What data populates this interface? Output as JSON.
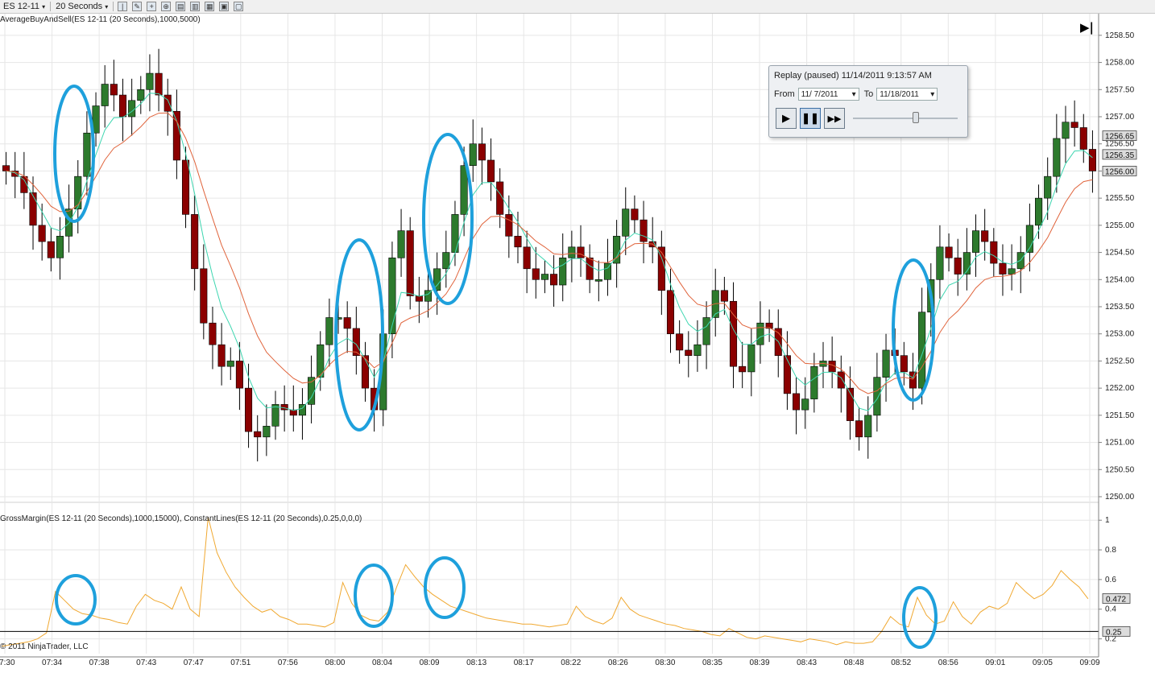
{
  "toolbar": {
    "instrument": "ES 12-11",
    "interval": "20 Seconds"
  },
  "upper_panel": {
    "indicator_label": "AverageBuyAndSell(ES 12-11 (20 Seconds),1000,5000)",
    "price_ticks": [
      "1258.50",
      "1258.00",
      "1257.50",
      "1257.00",
      "1256.50",
      "1256.00",
      "1255.50",
      "1255.00",
      "1254.50",
      "1254.00",
      "1253.50",
      "1253.00",
      "1252.50",
      "1252.00",
      "1251.50",
      "1251.00",
      "1250.50",
      "1250.00"
    ],
    "price_markers": [
      "1256.65",
      "1256.35",
      "1256.00"
    ],
    "jump_to_end_label": "▶|"
  },
  "lower_panel": {
    "indicator_label": "GrossMargin(ES 12-11 (20 Seconds),1000,15000), ConstantLines(ES 12-11 (20 Seconds),0.25,0,0,0)",
    "ticks": [
      "1",
      "0.8",
      "0.6",
      "0.4",
      "0.2"
    ],
    "value_markers": [
      "0.472",
      "0.25"
    ],
    "copyright": "© 2011 NinjaTrader, LLC"
  },
  "time_axis": [
    "07:30",
    "07:34",
    "07:38",
    "07:43",
    "07:47",
    "07:51",
    "07:56",
    "08:00",
    "08:04",
    "08:09",
    "08:13",
    "08:17",
    "08:22",
    "08:26",
    "08:30",
    "08:35",
    "08:39",
    "08:43",
    "08:48",
    "08:52",
    "08:56",
    "09:01",
    "09:05",
    "09:09"
  ],
  "replay": {
    "title": "Replay (paused) 11/14/2011 9:13:57 AM",
    "from_label": "From",
    "from_value": "11/ 7/2011",
    "to_label": "To",
    "to_value": "11/18/2011"
  },
  "colors": {
    "up_candle": "#2d7a2d",
    "down_candle": "#8b0000",
    "fast_avg": "#3dd6b0",
    "slow_avg": "#e0643c",
    "gross_margin": "#f0a830",
    "constant_line": "#000000",
    "highlight_circle": "#1ea0dc"
  },
  "chart_data": [
    {
      "type": "candlestick",
      "title": "AverageBuyAndSell(ES 12-11 (20 Seconds),1000,5000)",
      "ylim": [
        1250.0,
        1258.75
      ],
      "x_ticks": [
        "07:30",
        "07:34",
        "07:38",
        "07:43",
        "07:47",
        "07:51",
        "07:56",
        "08:00",
        "08:04",
        "08:09",
        "08:13",
        "08:17",
        "08:22",
        "08:26",
        "08:30",
        "08:35",
        "08:39",
        "08:43",
        "08:48",
        "08:52",
        "08:56",
        "09:01",
        "09:05",
        "09:09"
      ],
      "close_path": [
        1256.0,
        1255.9,
        1255.6,
        1255.0,
        1254.7,
        1254.4,
        1254.8,
        1255.3,
        1255.9,
        1256.7,
        1257.2,
        1257.6,
        1257.4,
        1257.0,
        1257.3,
        1257.5,
        1257.8,
        1257.4,
        1257.1,
        1256.2,
        1255.2,
        1254.2,
        1253.2,
        1252.8,
        1252.4,
        1252.5,
        1252.0,
        1251.2,
        1251.1,
        1251.3,
        1251.7,
        1251.6,
        1251.5,
        1251.7,
        1252.2,
        1252.8,
        1253.3,
        1253.3,
        1253.1,
        1252.6,
        1252.0,
        1251.6,
        1253.0,
        1254.4,
        1254.9,
        1253.7,
        1253.6,
        1253.8,
        1254.2,
        1254.5,
        1255.2,
        1256.1,
        1256.5,
        1256.2,
        1255.8,
        1255.2,
        1254.8,
        1254.6,
        1254.2,
        1254.0,
        1254.1,
        1253.9,
        1254.4,
        1254.6,
        1254.4,
        1254.0,
        1254.0,
        1254.3,
        1254.8,
        1255.3,
        1255.1,
        1254.7,
        1254.6,
        1253.8,
        1253.0,
        1252.7,
        1252.6,
        1252.8,
        1253.3,
        1253.8,
        1253.6,
        1252.4,
        1252.3,
        1252.8,
        1253.2,
        1253.1,
        1252.6,
        1251.9,
        1251.6,
        1251.8,
        1252.4,
        1252.5,
        1252.3,
        1252.0,
        1251.4,
        1251.1,
        1251.5,
        1252.2,
        1252.7,
        1252.6,
        1252.3,
        1252.0,
        1253.4,
        1254.0,
        1254.6,
        1254.4,
        1254.1,
        1254.5,
        1254.9,
        1254.7,
        1254.3,
        1254.1,
        1254.2,
        1254.5,
        1255.0,
        1255.5,
        1255.9,
        1256.6,
        1256.9,
        1256.8,
        1256.4,
        1256.0
      ]
    },
    {
      "type": "line",
      "title": "GrossMargin(ES 12-11 (20 Seconds),1000,15000), ConstantLines(ES 12-11 (20 Seconds),0.25,0,0,0)",
      "ylim": [
        0.1,
        1.05
      ],
      "series": [
        {
          "name": "GrossMargin",
          "values": [
            0.15,
            0.16,
            0.17,
            0.18,
            0.2,
            0.24,
            0.52,
            0.46,
            0.4,
            0.37,
            0.36,
            0.34,
            0.33,
            0.31,
            0.3,
            0.42,
            0.5,
            0.46,
            0.44,
            0.4,
            0.55,
            0.4,
            0.35,
            1.02,
            0.78,
            0.65,
            0.55,
            0.48,
            0.42,
            0.38,
            0.4,
            0.35,
            0.33,
            0.3,
            0.3,
            0.29,
            0.28,
            0.31,
            0.58,
            0.44,
            0.36,
            0.33,
            0.32,
            0.38,
            0.55,
            0.7,
            0.62,
            0.55,
            0.5,
            0.46,
            0.42,
            0.4,
            0.38,
            0.36,
            0.34,
            0.33,
            0.32,
            0.31,
            0.3,
            0.3,
            0.29,
            0.28,
            0.29,
            0.3,
            0.42,
            0.35,
            0.32,
            0.3,
            0.34,
            0.48,
            0.4,
            0.36,
            0.34,
            0.32,
            0.3,
            0.29,
            0.27,
            0.26,
            0.25,
            0.23,
            0.22,
            0.27,
            0.24,
            0.21,
            0.2,
            0.22,
            0.21,
            0.2,
            0.19,
            0.18,
            0.2,
            0.19,
            0.18,
            0.16,
            0.18,
            0.17,
            0.17,
            0.18,
            0.25,
            0.35,
            0.3,
            0.28,
            0.48,
            0.36,
            0.3,
            0.32,
            0.45,
            0.35,
            0.3,
            0.38,
            0.42,
            0.4,
            0.44,
            0.58,
            0.52,
            0.47,
            0.5,
            0.56,
            0.66,
            0.6,
            0.55,
            0.47
          ]
        },
        {
          "name": "ConstantLines",
          "values": [
            0.25
          ]
        }
      ]
    }
  ]
}
